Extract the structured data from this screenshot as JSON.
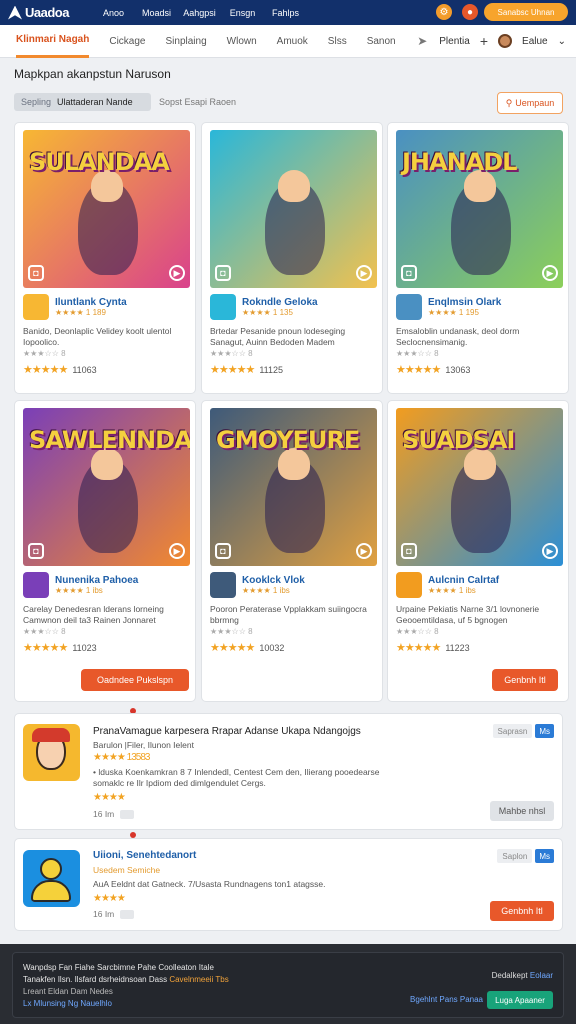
{
  "topbar": {
    "logo": "Uaadoa",
    "nav": [
      "Anoo",
      "Moadsi",
      "Aahgpsi",
      "Ensgn",
      "Fahlps"
    ],
    "cta": "Sanabsc Uhnan"
  },
  "tabs": {
    "items": [
      "Klinmari Nagah",
      "Cickage",
      "Sinplaing",
      "Wlown",
      "Amuok",
      "Slss",
      "Sanon"
    ],
    "right_label": "Plentia",
    "profile_label": "Ealue"
  },
  "section": {
    "title": "Mapkpan akanpstun Naruson",
    "filter_chip_muted": "Sepling",
    "filter_chip_value": "Ulattaderan Nande",
    "filter_extra": "Sopst Esapi Raoen",
    "search_button": "Uempaun"
  },
  "cards": [
    {
      "art_title": "SULANDAA",
      "name": "Iluntlank Cynta",
      "sub": "★★★★ 1 189",
      "desc": "Banido, Deonlaplic Velidey koolt ulentol Iopoolico.",
      "small": "★★★☆☆ 8",
      "count": "11063",
      "colors": [
        "#f7b733",
        "#d9428c"
      ]
    },
    {
      "art_title": "",
      "name": "Rokndle Geloka",
      "sub": "★★★★ 1 135",
      "desc": "Brtedar Pesanide pnoun lodeseging Sanagut, Auinn Bedoden Madem",
      "small": "★★★☆☆ 8",
      "count": "11125",
      "colors": [
        "#2ab7d9",
        "#f2c14e"
      ]
    },
    {
      "art_title": "JHANADL",
      "name": "Enqlmsin Olark",
      "sub": "★★★★ 1 195",
      "desc": "Emsaloblin undanask, deol dorm Seclocnensimanig.",
      "small": "★★★☆☆ 8",
      "count": "13063",
      "colors": [
        "#4a90c2",
        "#8ccf5a"
      ]
    },
    {
      "art_title": "SAWLENNDA",
      "name": "Nunenika Pahoea",
      "sub": "★★★★ 1 ibs",
      "desc": "Carelay Denedesran lderans lorneing Camwnon deil ta3 Rainen Jonnaret",
      "small": "★★★☆☆ 8",
      "count": "11023",
      "colors": [
        "#7a3fb8",
        "#f28a2e"
      ]
    },
    {
      "art_title": "GMOYEURE",
      "name": "Kooklck Vlok",
      "sub": "★★★★ 1 ibs",
      "desc": "Pooron Peraterase Vpplakkam suiingocra bbrmng",
      "small": "★★★☆☆ 8",
      "count": "10032",
      "colors": [
        "#3e5a7a",
        "#e0a040"
      ]
    },
    {
      "art_title": "SUADSAI",
      "name": "Aulcnin Calrtaf",
      "sub": "★★★★ 1 ibs",
      "desc": "Urpaine Pekiatis Narne 3/1 lovnonerie Geooemtildasa, uf 5 bgnogen",
      "small": "★★★☆☆ 8",
      "count": "11223",
      "colors": [
        "#f29c1f",
        "#2b8fd6"
      ]
    }
  ],
  "card_ctas": {
    "left": "Oadndee Pukslspn",
    "right": "Genbnh Itl"
  },
  "rows": [
    {
      "title": "PranaVamague karpesera Rrapar Adanse Ukapa Ndangojgs",
      "sub": "Barulon |Filer, Ilunon Ielent",
      "stars": "★★★★ 13583",
      "text": "• lduska Koenkamkran 8 7 Inlendedl, Centest Cem den, Ilierang pooedearse somaklc re Ilr Ipdiom ded dimlgendulet Cergs.",
      "rating": "★★★★",
      "meta": "16 Im",
      "tag": "Saprasn",
      "tag_blue": "Ms",
      "button": "Mahbe nhsl"
    },
    {
      "title": "Uiioni, Senehtedanort",
      "sub": "Usedem Semiche",
      "text": "AuA Eeldnt dat Gatneck. 7/Usasta Rundnagens ton1 atagsse.",
      "rating": "★★★★",
      "meta": "16 Im",
      "tag": "Saplon",
      "tag_blue": "Ms",
      "button": "Genbnh Itl"
    }
  ],
  "footer": {
    "line1": "Wanpdsp Fan Fiahe Sarcbimne Pahe Coolleaton Itale",
    "line2a": "Tanakfen Ilsn. Ilsfard dsrheidnsoan Dass",
    "line2b": "Cavelnmeeii Tbs",
    "line3": "Lreant Eldan Dam Nedes",
    "line4": "Lx Mlunsing Ng Nauelhlo",
    "right1a": "Dedalkept",
    "right1b": "Eolaar",
    "link": "Bgehlnt Pans Panaa",
    "button": "Luga Apaaner"
  }
}
